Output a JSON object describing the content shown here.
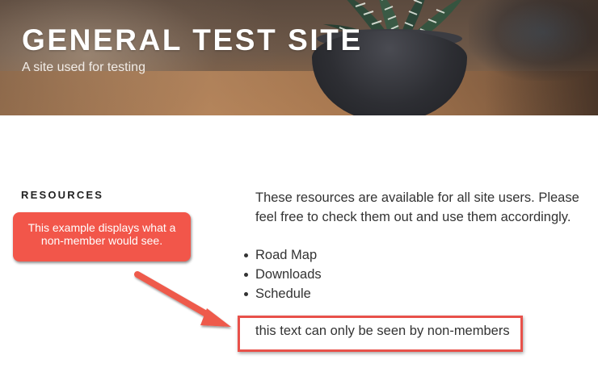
{
  "header": {
    "site_title": "GENERAL TEST SITE",
    "tagline": "A site used for testing"
  },
  "sidebar": {
    "heading": "RESOURCES"
  },
  "annotation": {
    "callout_line1": "This example displays what a",
    "callout_line2": "non-member would see.",
    "color": "#f2564a"
  },
  "main": {
    "intro": "These resources are available for all site users. Please feel free to check them out and use them accordingly.",
    "list_items": [
      "Road Map",
      "Downloads",
      "Schedule"
    ],
    "nonmember_text": "this text can only be seen by non-members"
  },
  "colors": {
    "text": "#333333",
    "highlight_border": "#e8514a"
  }
}
